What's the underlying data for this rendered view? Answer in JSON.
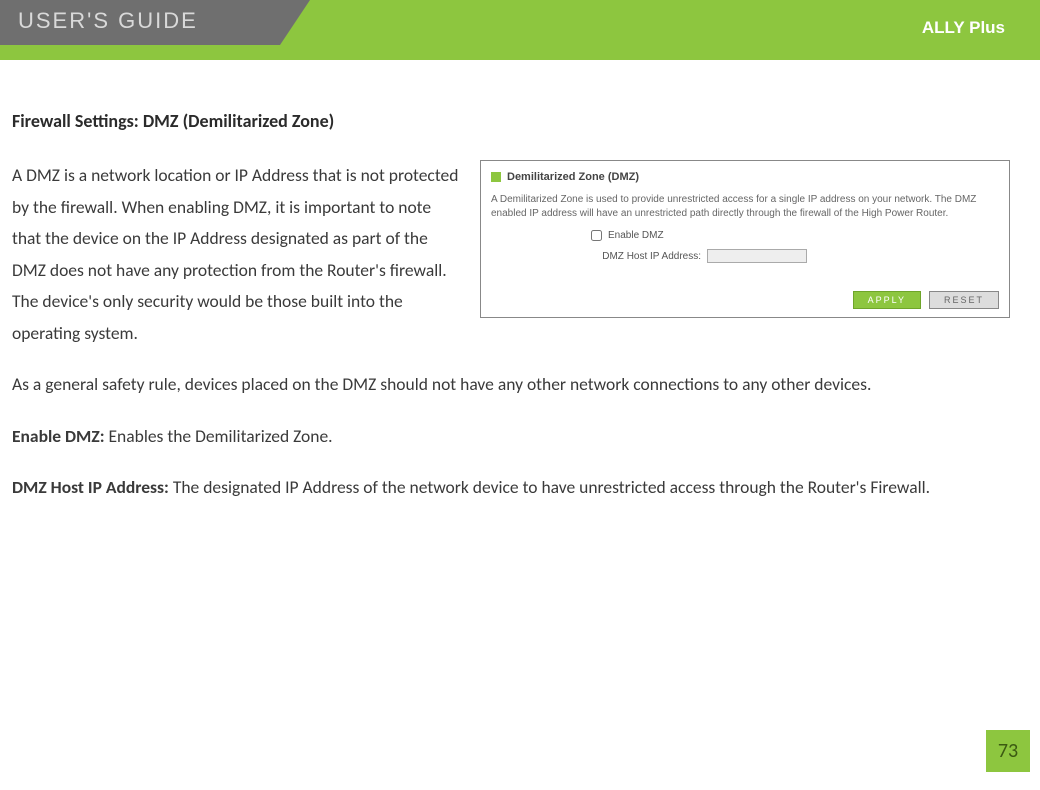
{
  "header": {
    "title": "USER'S GUIDE",
    "brand": "ALLY Plus"
  },
  "sectionTitle": "Firewall Settings: DMZ (Demilitarized Zone)",
  "body": {
    "p1": "A DMZ is a network location or IP Address that is not protected by the firewall.  When enabling DMZ, it is important to note that the device on the IP Address designated as part of the DMZ does not have any protection from the Router's firewall.  The device's only security would be those built into the operating system.",
    "p2": "As a general safety rule, devices placed on the DMZ should not have any other network connections to any other devices.",
    "enableLabel": "Enable DMZ:",
    "enableText": " Enables the Demilitarized Zone.",
    "hostLabel": "DMZ Host IP Address:",
    "hostText": " The designated IP Address of the network device to have unrestricted access through the Router's Firewall."
  },
  "screenshot": {
    "title": "Demilitarized Zone (DMZ)",
    "desc": "A Demilitarized Zone is used to provide unrestricted access for a single IP address on your network. The DMZ enabled IP address will have an unrestricted path directly through the firewall of the High Power Router.",
    "enableLabel": "Enable DMZ",
    "hostLabel": "DMZ Host IP Address:",
    "hostValue": "",
    "apply": "APPLY",
    "reset": "RESET"
  },
  "pageNumber": "73"
}
